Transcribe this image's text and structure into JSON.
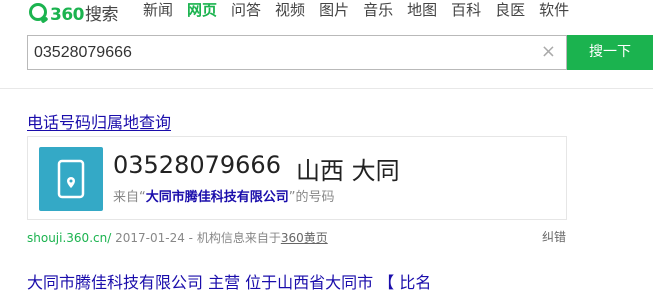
{
  "logo": {
    "brand": "360",
    "product": "搜索"
  },
  "nav": {
    "items": [
      "新闻",
      "网页",
      "问答",
      "视频",
      "图片",
      "音乐",
      "地图",
      "百科",
      "良医",
      "软件"
    ],
    "active": "网页"
  },
  "search": {
    "query": "03528079666",
    "clear_label": "×",
    "button_label": "搜一下"
  },
  "result": {
    "title": "电话号码归属地查询",
    "phone_number": "03528079666",
    "location": "山西 大同",
    "from_prefix": "来自“",
    "company": "大同市腾佳科技有限公司",
    "from_suffix": "”的号码",
    "icon": "mobile-phone-location-icon"
  },
  "meta": {
    "url": "shouji.360.cn/",
    "date": "2017-01-24",
    "source_text": "- 机构信息来自于",
    "source_link": "360黄页",
    "report_label": "纠错"
  },
  "next_result": {
    "title": "大同市腾佳科技有限公司 主营 位于山西省大同市 【 比名"
  }
}
